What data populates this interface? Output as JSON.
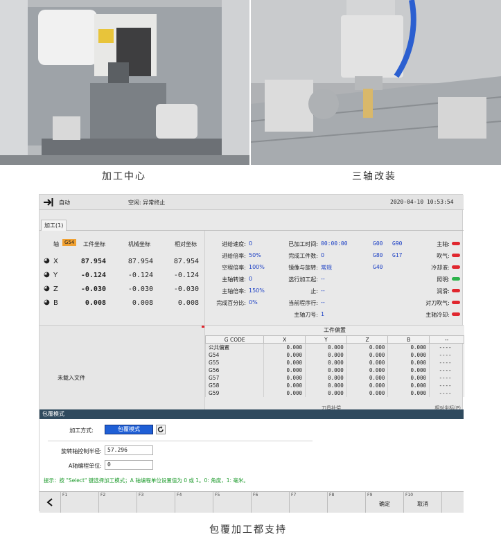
{
  "captions": {
    "machining_center": "加工中心",
    "three_axis": "三轴改装",
    "wrap_support": "包覆加工都支持"
  },
  "hmi": {
    "mode_label": "自动",
    "status_text": "空闲: 异常终止",
    "datetime": "2020-04-10 10:53:54",
    "tab_label": "加工(1)",
    "coords": {
      "axis_header": "轴",
      "wcs_badge": "G54",
      "col_work": "工件坐标",
      "col_machine": "机械坐标",
      "col_relative": "相对坐标",
      "rows": [
        {
          "axis": "X",
          "work": "87.954",
          "machine": "87.954",
          "relative": "87.954"
        },
        {
          "axis": "Y",
          "work": "-0.124",
          "machine": "-0.124",
          "relative": "-0.124"
        },
        {
          "axis": "Z",
          "work": "-0.030",
          "machine": "-0.030",
          "relative": "-0.030"
        },
        {
          "axis": "B",
          "work": "0.008",
          "machine": "0.008",
          "relative": "0.008"
        }
      ]
    },
    "status": {
      "feed_speed_label": "进给速度:",
      "feed_speed": "0",
      "feed_ratio_label": "进给倍率:",
      "feed_ratio": "50%",
      "rapid_ratio_label": "空程倍率:",
      "rapid_ratio": "100%",
      "spindle_speed_label": "主轴转速:",
      "spindle_speed": "0",
      "spindle_ratio_label": "主轴倍率:",
      "spindle_ratio": "150%",
      "complete_pct_label": "完成百分比:",
      "complete_pct": "0%",
      "machined_time_label": "已加工时间:",
      "machined_time": "00:00:00",
      "pieces_label": "完成工件数:",
      "pieces": "0",
      "mirror_label": "镜像与旋转:",
      "mirror": "常规",
      "select_start_label": "选行加工起:",
      "select_start": "--",
      "select_end_label": "止:",
      "select_end": "--",
      "current_line_label": "当前程序行:",
      "current_line": "--",
      "spindle_tool_label": "主轴刀号:",
      "spindle_tool": "1",
      "gcodes": [
        "G00",
        "G90",
        "G80",
        "G17",
        "G40"
      ],
      "indicators": [
        {
          "label": "主轴:",
          "state": "red"
        },
        {
          "label": "吹气:",
          "state": "red"
        },
        {
          "label": "冷却液:",
          "state": "red"
        },
        {
          "label": "照明:",
          "state": "green"
        },
        {
          "label": "润滑:",
          "state": "red"
        },
        {
          "label": "对刀吹气:",
          "state": "red"
        },
        {
          "label": "主轴冷却:",
          "state": "red"
        }
      ]
    },
    "file_status": "未载入文件",
    "offset": {
      "title": "工件偏置",
      "headers": [
        "G CODE",
        "X",
        "Y",
        "Z",
        "B",
        "--"
      ],
      "rows": [
        [
          "公共偏置",
          "0.000",
          "0.000",
          "0.000",
          "0.000",
          "----"
        ],
        [
          "G54",
          "0.000",
          "0.000",
          "0.000",
          "0.000",
          "----"
        ],
        [
          "G55",
          "0.000",
          "0.000",
          "0.000",
          "0.000",
          "----"
        ],
        [
          "G56",
          "0.000",
          "0.000",
          "0.000",
          "0.000",
          "----"
        ],
        [
          "G57",
          "0.000",
          "0.000",
          "0.000",
          "0.000",
          "----"
        ],
        [
          "G58",
          "0.000",
          "0.000",
          "0.000",
          "0.000",
          "----"
        ],
        [
          "G59",
          "0.000",
          "0.000",
          "0.000",
          "0.000",
          "----"
        ]
      ],
      "footer_left": "刀具补偿",
      "footer_right": "相对坐标(P)"
    },
    "mode_bar": "包覆模式",
    "form": {
      "method_label": "加工方式:",
      "method_value": "包覆模式",
      "radius_label": "旋转轴控制半径:",
      "radius_value": "57.296",
      "unit_label": "A轴编程单位:",
      "unit_value": "0",
      "hint": "提示：按 \"Select\" 键选择加工模式；A 轴编程单位设置值为 0 或 1。0: 角度，1: 毫米。"
    },
    "fkeys": [
      {
        "key": "F1",
        "action": ""
      },
      {
        "key": "F2",
        "action": ""
      },
      {
        "key": "F3",
        "action": ""
      },
      {
        "key": "F4",
        "action": ""
      },
      {
        "key": "F5",
        "action": ""
      },
      {
        "key": "F6",
        "action": ""
      },
      {
        "key": "F7",
        "action": ""
      },
      {
        "key": "F8",
        "action": ""
      },
      {
        "key": "F9",
        "action": "确定"
      },
      {
        "key": "F10",
        "action": "取消"
      }
    ]
  }
}
